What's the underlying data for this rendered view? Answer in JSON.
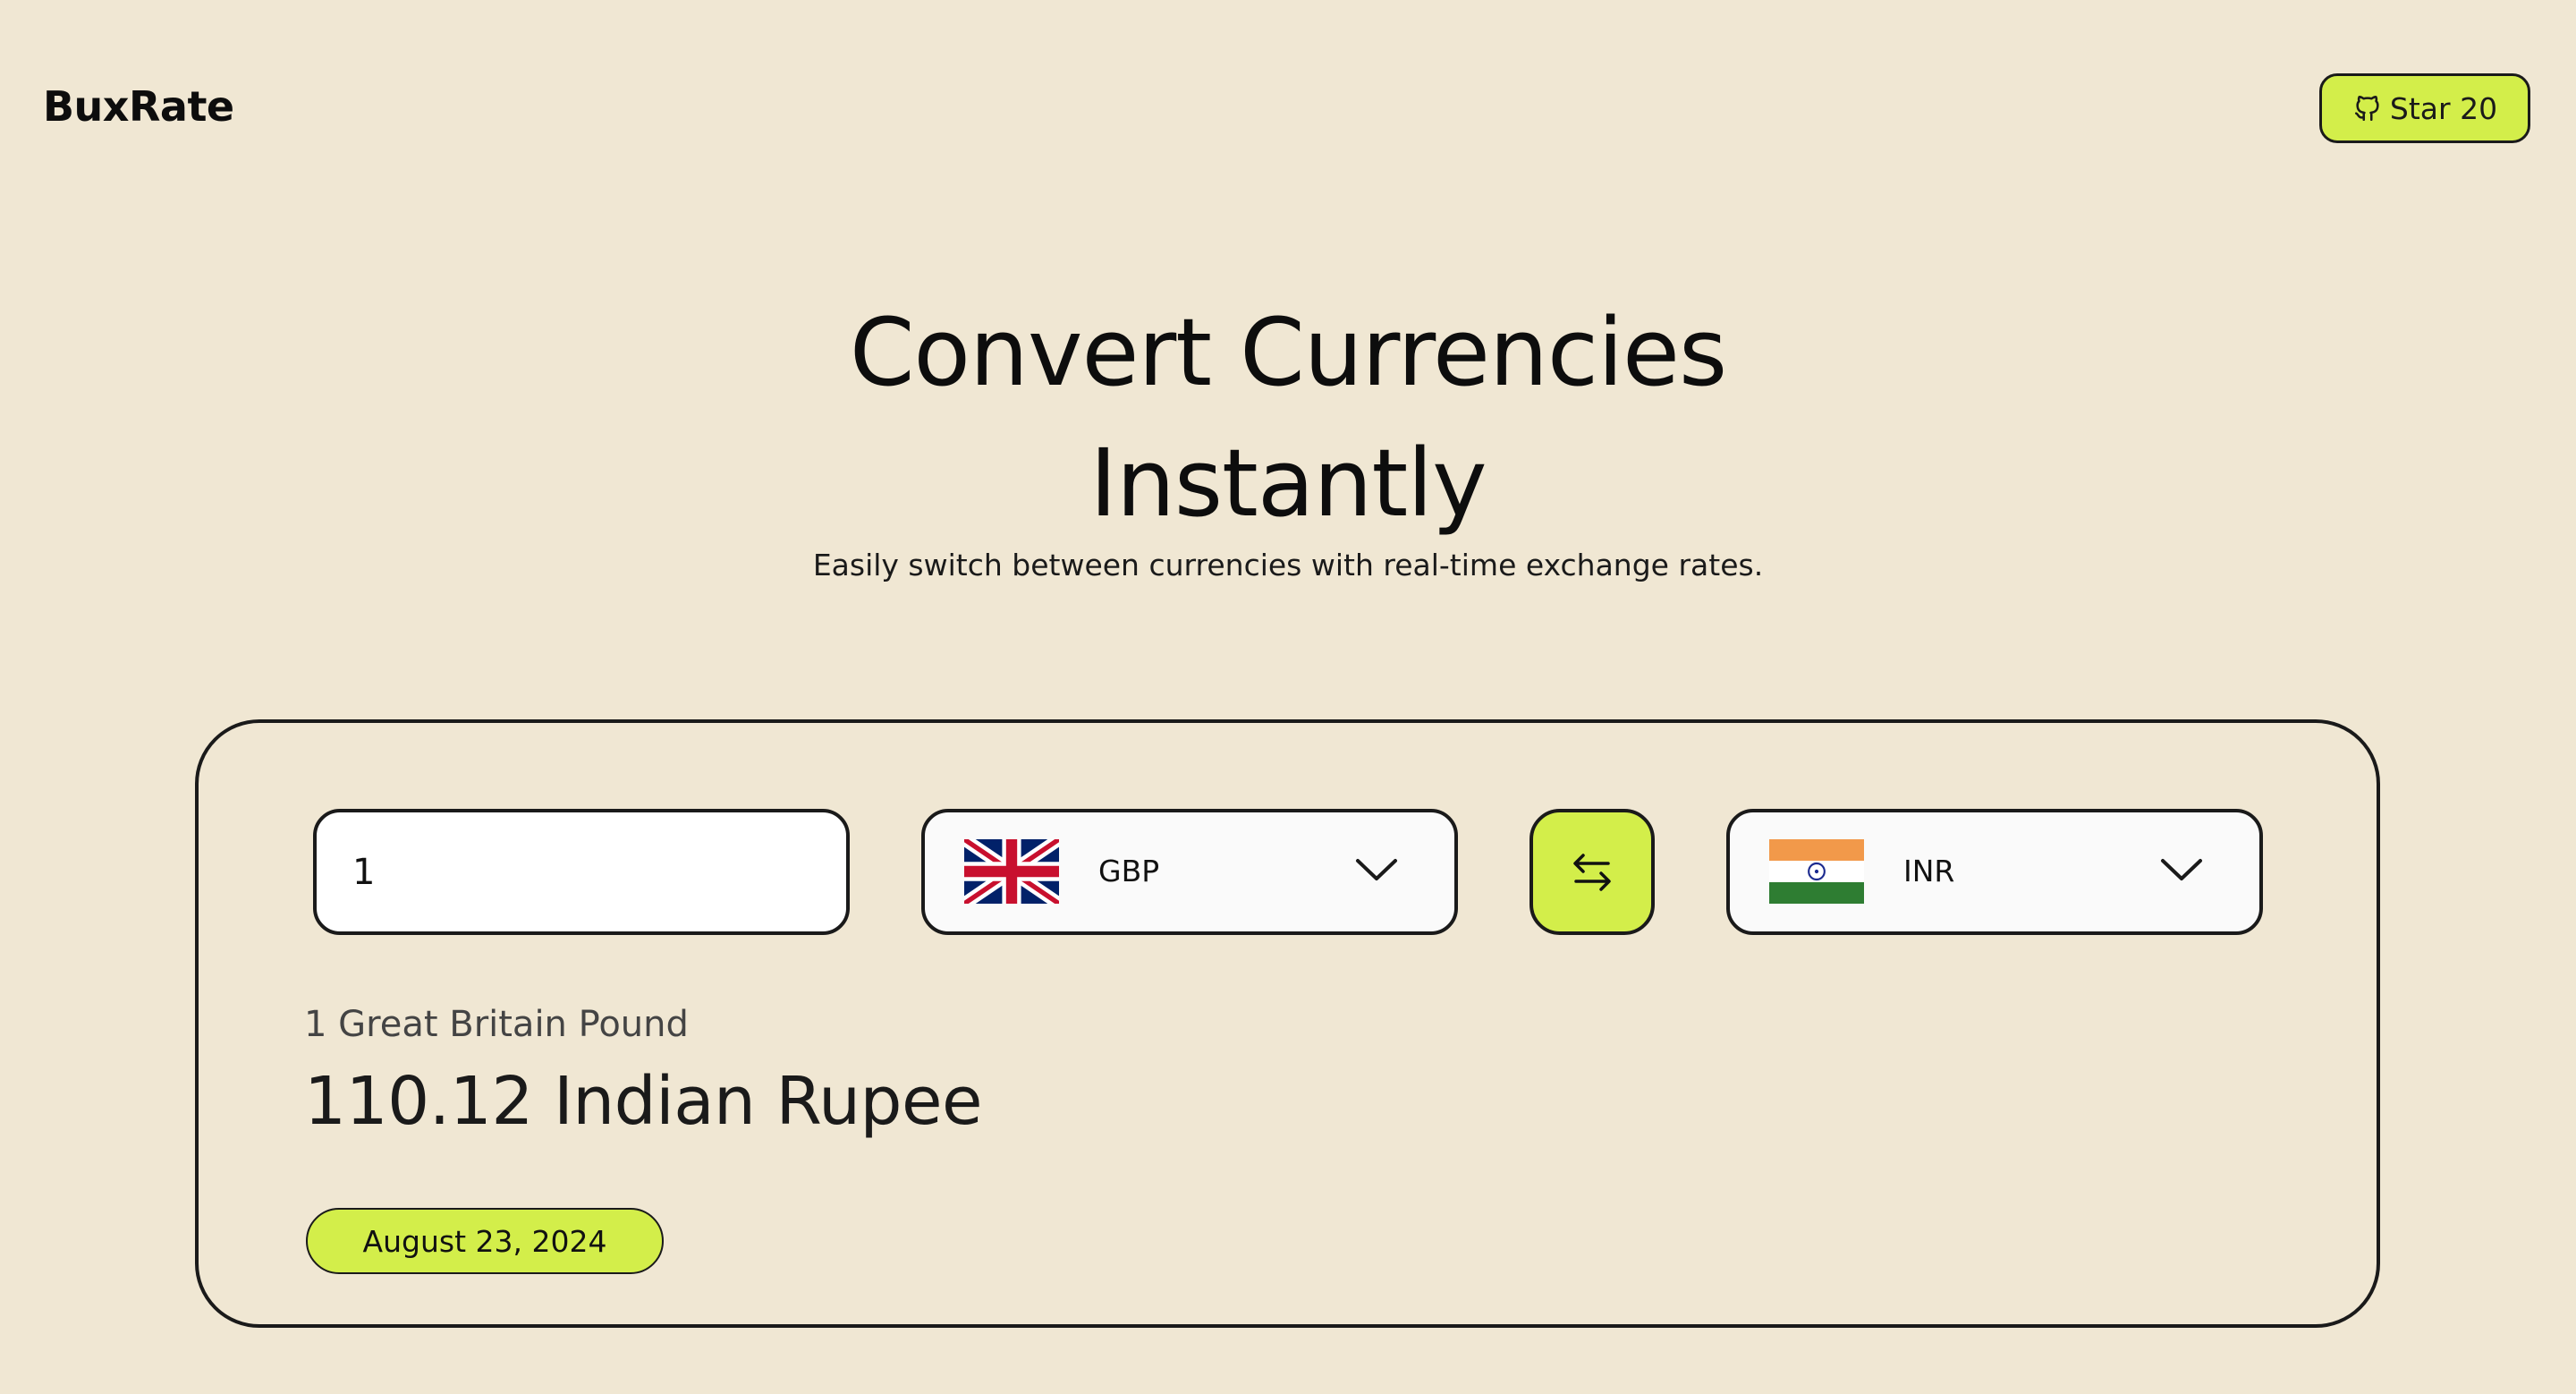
{
  "header": {
    "brand": "BuxRate",
    "star_button": {
      "icon": "github-icon",
      "label": "Star 20"
    }
  },
  "hero": {
    "title_line_1": "Convert Currencies",
    "title_line_2": "Instantly",
    "subtitle": "Easily switch between currencies with real-time exchange rates."
  },
  "converter": {
    "amount": "1",
    "from_currency": {
      "code": "GBP",
      "flag": "uk-flag"
    },
    "swap_button": {
      "icon": "swap-arrows-icon"
    },
    "to_currency": {
      "code": "INR",
      "flag": "india-flag"
    },
    "from_label": "1 Great Britain Pound",
    "result": "110.12 Indian Rupee",
    "date": "August 23, 2024"
  },
  "colors": {
    "background": "#F0E7D3",
    "accent": "#D3EE4A",
    "border": "#1A1A1A"
  }
}
